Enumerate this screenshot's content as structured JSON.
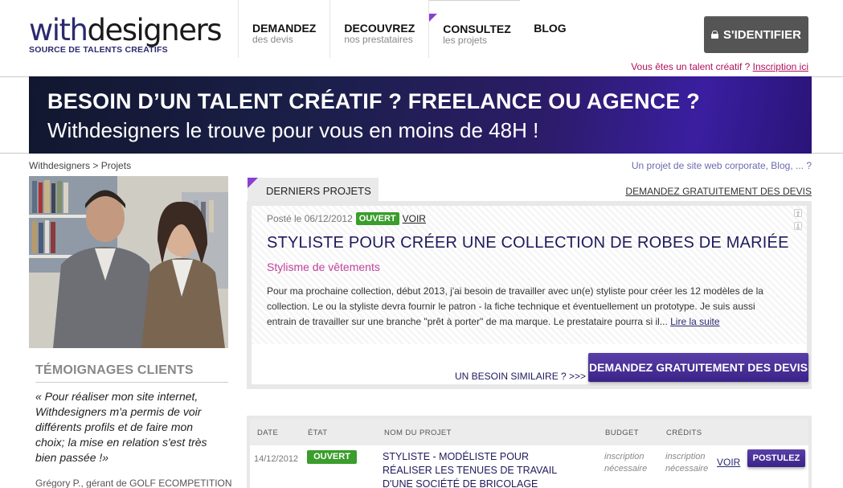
{
  "header": {
    "logo_prefix": "with",
    "logo_suffix": "designers",
    "logo_tagline": "SOURCE DE TALENTS CREATIFS",
    "nav": [
      {
        "title": "DEMANDEZ",
        "subtitle": "des devis"
      },
      {
        "title": "DECOUVREZ",
        "subtitle": "nos prestataires"
      },
      {
        "title": "CONSULTEZ",
        "subtitle": "les projets"
      },
      {
        "title": "BLOG",
        "subtitle": ""
      }
    ],
    "login_label": "S'IDENTIFIER",
    "talent_question": "Vous êtes un talent créatif ?",
    "talent_link": "Inscription ici"
  },
  "banner": {
    "line1": "BESOIN D’UN TALENT CRÉATIF ? FREELANCE OU AGENCE ?",
    "line2": "Withdesigners le trouve pour vous en moins de 48H !"
  },
  "breadcrumb": {
    "home": "Withdesigners",
    "separator": " > ",
    "current": "Projets"
  },
  "hint": "Un projet de site web corporate, Blog, ... ?",
  "testimonials": {
    "title": "TÉMOIGNAGES CLIENTS",
    "quote": "« Pour réaliser mon site internet, Withdesigners m'a permis de voir différents profils et de faire mon choix; la mise en relation s'est très bien passée !»",
    "author": "Grégory P., gérant de GOLF ECOMPETITION"
  },
  "latest": {
    "tab_label": "DERNIERS PROJETS",
    "ask_link": "DEMANDEZ GRATUITEMENT DES DEVIS",
    "featured": {
      "posted": "Posté le 06/12/2012",
      "status": "OUVERT",
      "view": "VOIR",
      "title": "STYLISTE POUR CRÉER UNE COLLECTION DE ROBES DE MARIÉE",
      "category": "Stylisme de vêtements",
      "description": "Pour ma prochaine collection, début 2013, j'ai besoin de travailler avec un(e) styliste pour créer les 12 modèles de la collection. Le ou la styliste devra fournir le patron - la fiche technique et éventuellement un prototype. Je suis aussi entrain de travailler sur une branche \"prêt à porter\" de ma marque. Le prestataire pourra si il...",
      "read_more": "Lire la suite",
      "similar": "UN BESOIN SIMILAIRE ? >>>",
      "ask_button": "DEMANDEZ GRATUITEMENT DES DEVIS"
    }
  },
  "table": {
    "headers": {
      "date": "DATE",
      "status": "ÉTAT",
      "name": "NOM DU PROJET",
      "budget": "BUDGET",
      "credits": "CRÉDITS"
    },
    "rows": [
      {
        "date": "14/12/2012",
        "status": "OUVERT",
        "name": "STYLISTE - MODÉLISTE POUR RÉALISER LES TENUES DE TRAVAIL D'UNE SOCIÉTÉ DE BRICOLAGE",
        "budget": "inscription nécessaire",
        "credits": "inscription nécessaire",
        "view": "VOIR",
        "apply": "POSTULEZ"
      }
    ]
  },
  "colors": {
    "brand_navy": "#2b2a6e",
    "accent_purple": "#8b3fcf",
    "status_green": "#3a9d2c",
    "pink_link": "#b0115a"
  }
}
